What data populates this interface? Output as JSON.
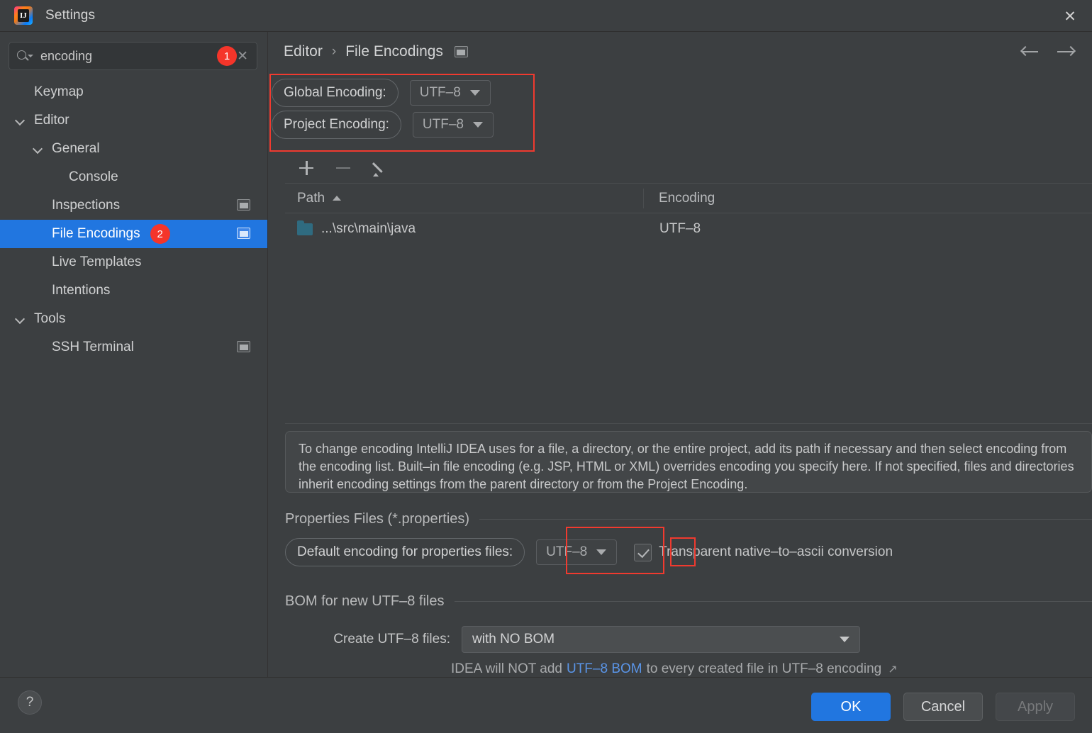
{
  "window": {
    "title": "Settings",
    "logo_icon": "intellij-idea-logo",
    "logo_mark": "IJ",
    "close_icon": "close-icon"
  },
  "search": {
    "value": "encoding",
    "placeholder": "Search settings",
    "badge": "1",
    "search_icon": "search-icon",
    "clear_icon": "clear-icon"
  },
  "sidebar": {
    "items": [
      {
        "label": "Keymap",
        "indent": 48,
        "arrow": false,
        "cfg": false,
        "selected": false,
        "badge": ""
      },
      {
        "label": "Editor",
        "indent": 48,
        "arrow": true,
        "cfg": false,
        "selected": false,
        "badge": ""
      },
      {
        "label": "General",
        "indent": 73,
        "arrow": true,
        "cfg": false,
        "selected": false,
        "badge": ""
      },
      {
        "label": "Console",
        "indent": 97,
        "arrow": false,
        "cfg": false,
        "selected": false,
        "badge": ""
      },
      {
        "label": "Inspections",
        "indent": 73,
        "arrow": false,
        "cfg": true,
        "selected": false,
        "badge": ""
      },
      {
        "label": "File Encodings",
        "indent": 73,
        "arrow": false,
        "cfg": true,
        "selected": true,
        "badge": "2"
      },
      {
        "label": "Live Templates",
        "indent": 73,
        "arrow": false,
        "cfg": false,
        "selected": false,
        "badge": ""
      },
      {
        "label": "Intentions",
        "indent": 73,
        "arrow": false,
        "cfg": false,
        "selected": false,
        "badge": ""
      },
      {
        "label": "Tools",
        "indent": 48,
        "arrow": true,
        "cfg": false,
        "selected": false,
        "badge": ""
      },
      {
        "label": "SSH Terminal",
        "indent": 73,
        "arrow": false,
        "cfg": true,
        "selected": false,
        "badge": ""
      }
    ]
  },
  "breadcrumb": {
    "parent": "Editor",
    "separator": "›",
    "current": "File Encodings",
    "cfg_icon": "settings-window-icon",
    "back_icon": "arrow-left-icon",
    "forward_icon": "arrow-right-icon"
  },
  "encodings": {
    "global_label": "Global Encoding:",
    "global_value": "UTF–8",
    "project_label": "Project Encoding:",
    "project_value": "UTF–8"
  },
  "toolbar": {
    "add_icon": "plus-icon",
    "remove_icon": "minus-icon",
    "edit_icon": "pencil-icon"
  },
  "table": {
    "columns": [
      "Path",
      "Encoding"
    ],
    "sort_indicator": "sort-ascending-icon",
    "rows": [
      {
        "path": "...\\src\\main\\java",
        "encoding": "UTF–8",
        "icon": "folder-icon"
      }
    ]
  },
  "info": {
    "text": "To change encoding IntelliJ IDEA uses for a file, a directory, or the entire project, add its path if necessary and then select encoding from the encoding list. Built–in file encoding (e.g. JSP, HTML or XML) overrides encoding you specify here. If not specified, files and directories inherit encoding settings from the parent directory or from the Project Encoding."
  },
  "properties_section": {
    "title": "Properties Files (*.properties)",
    "default_label": "Default encoding for properties files:",
    "default_value": "UTF–8",
    "checkbox_label": "Transparent native–to–ascii conversion",
    "checkbox_checked": true
  },
  "bom_section": {
    "title": "BOM for new UTF–8 files",
    "create_label": "Create UTF–8 files:",
    "create_value": "with NO BOM",
    "hint_prefix": "IDEA will NOT add",
    "hint_link": "UTF–8 BOM",
    "hint_suffix": "to every created file in UTF–8 encoding",
    "external_icon": "external-link-icon"
  },
  "footer": {
    "help_label": "?",
    "ok_label": "OK",
    "cancel_label": "Cancel",
    "apply_label": "Apply"
  },
  "colors": {
    "accent": "#2176e0",
    "badge": "#f5352a",
    "annotation": "#f03a2f",
    "link": "#5a95e8",
    "folder": "#2f6b80",
    "background": "#3c3f41"
  }
}
